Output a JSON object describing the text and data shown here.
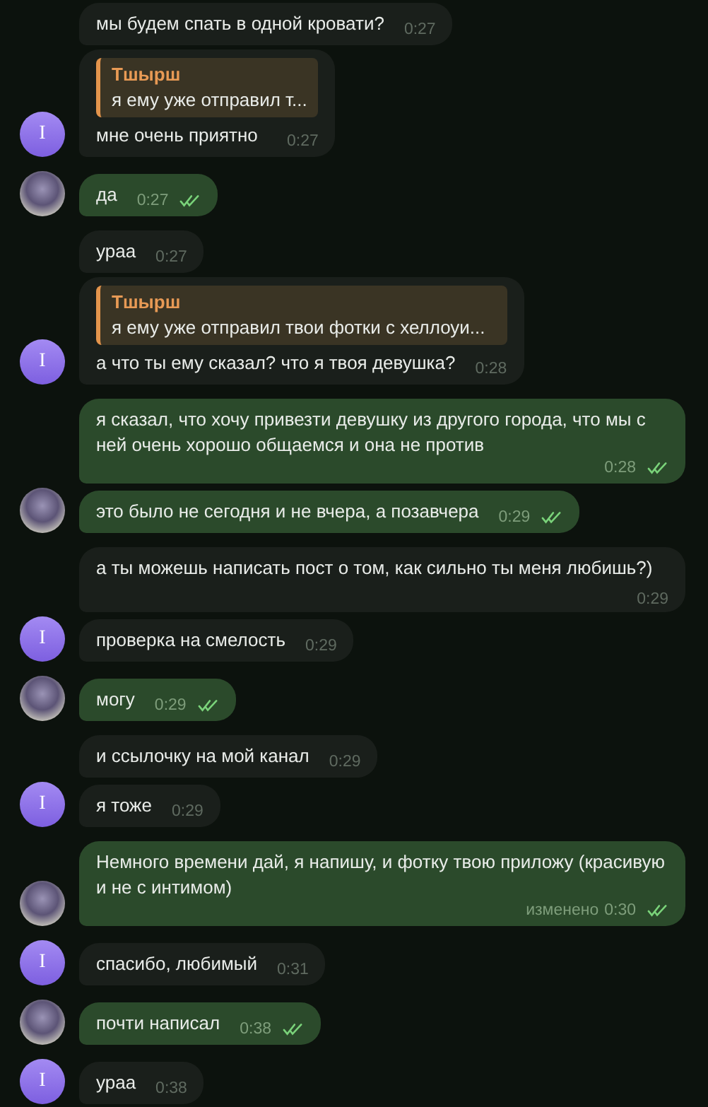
{
  "messages": [
    {
      "kind": "them",
      "avatar": false,
      "text": "мы будем спать в одной кровати?",
      "time": "0:27"
    },
    {
      "kind": "them",
      "avatar": true,
      "avatar_letter": "I",
      "reply": {
        "name": "Тшырш",
        "text": "я ему уже отправил т..."
      },
      "text": "мне очень приятно",
      "time": "0:27"
    },
    {
      "kind": "me",
      "avatar": true,
      "text": "да",
      "time": "0:27",
      "read": true
    },
    {
      "kind": "them",
      "avatar": false,
      "text": "ураа",
      "time": "0:27"
    },
    {
      "kind": "them",
      "avatar": true,
      "avatar_letter": "I",
      "reply": {
        "name": "Тшырш",
        "text": "я ему уже отправил твои фотки с хеллоуи..."
      },
      "text": "а что ты ему сказал? что я твоя девушка?",
      "time": "0:28"
    },
    {
      "kind": "me",
      "avatar": false,
      "text": "я сказал, что хочу привезти девушку из другого города, что мы с ней очень хорошо общаемся и она не против",
      "time": "0:28",
      "read": true
    },
    {
      "kind": "me",
      "avatar": true,
      "text": "это было не сегодня и не вчера, а позавчера",
      "time": "0:29",
      "read": true
    },
    {
      "kind": "them",
      "avatar": false,
      "text": "а ты можешь написать пост о том, как сильно ты меня любишь?)",
      "time": "0:29"
    },
    {
      "kind": "them",
      "avatar": true,
      "avatar_letter": "I",
      "text": "проверка на смелость",
      "time": "0:29"
    },
    {
      "kind": "me",
      "avatar": true,
      "text": "могу",
      "time": "0:29",
      "read": true
    },
    {
      "kind": "them",
      "avatar": false,
      "text": "и ссылочку на мой канал",
      "time": "0:29"
    },
    {
      "kind": "them",
      "avatar": true,
      "avatar_letter": "I",
      "text": "я тоже",
      "time": "0:29"
    },
    {
      "kind": "me",
      "avatar": true,
      "text": "Немного времени дай, я напишу, и фотку твою приложу (красивую и не с интимом)",
      "edited_label": "изменено",
      "time": "0:30",
      "read": true
    },
    {
      "kind": "them",
      "avatar": true,
      "avatar_letter": "I",
      "text": "спасибо, любимый",
      "time": "0:31"
    },
    {
      "kind": "me",
      "avatar": true,
      "text": "почти написал",
      "time": "0:38",
      "read": true
    },
    {
      "kind": "them",
      "avatar": true,
      "avatar_letter": "I",
      "text": "ураа",
      "time": "0:38"
    }
  ]
}
